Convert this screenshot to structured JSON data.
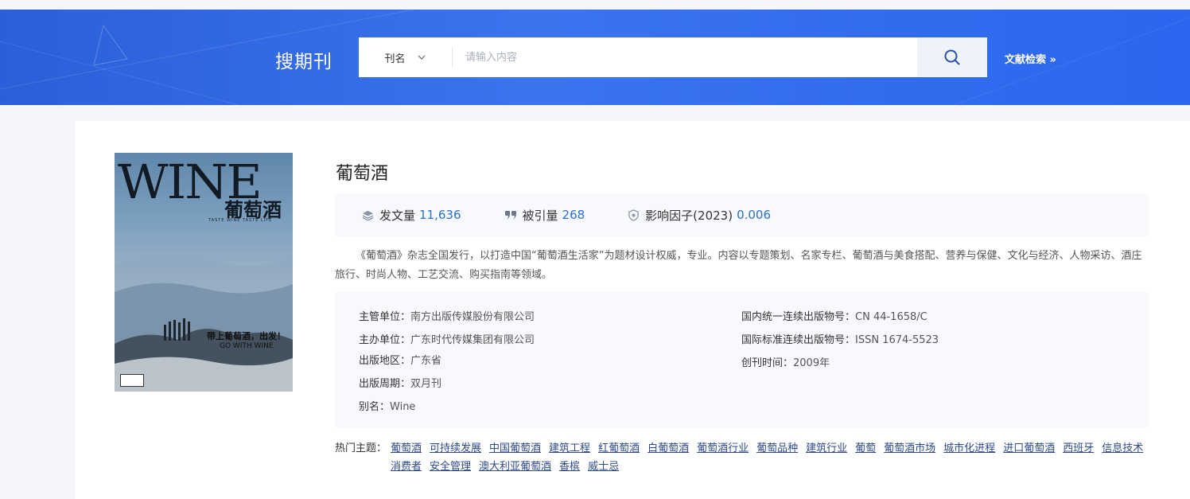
{
  "header": {
    "title": "搜期刊",
    "field_select": "刊名",
    "search_placeholder": "请输入内容",
    "advanced_link": "文献检索 »"
  },
  "journal": {
    "title": "葡萄酒",
    "cover": {
      "wine": "WINE",
      "cn": "葡萄酒",
      "sub": "TASTE WINE TASTE LIFE",
      "slogan": "带上葡萄酒，出发！",
      "slogan_en": "GO WITH WINE"
    },
    "stats": [
      {
        "label": "发文量",
        "value": "11,636",
        "icon": "stack-icon"
      },
      {
        "label": "被引量",
        "value": "268",
        "icon": "quote-icon"
      },
      {
        "label": "影响因子(2023)",
        "value": "0.006",
        "icon": "shield-icon"
      }
    ],
    "description": "《葡萄酒》杂志全国发行，以打造中国“葡萄酒生活家”为题材设计权威，专业。内容以专题策划、名家专栏、葡萄酒与美食搭配、营养与保健、文化与经济、人物采访、酒庄旅行、时尚人物、工艺交流、购买指南等领域。",
    "info_left": [
      {
        "label": "主管单位：",
        "value": "南方出版传媒股份有限公司"
      },
      {
        "label": "主办单位：",
        "value": "广东时代传媒集团有限公司"
      },
      {
        "label": "出版地区：",
        "value": "广东省"
      },
      {
        "label": "出版周期：",
        "value": "双月刊"
      },
      {
        "label": "别名：",
        "value": "Wine"
      }
    ],
    "info_right": [
      {
        "label": "国内统一连续出版物号：",
        "value": "CN 44-1658/C"
      },
      {
        "label": "国际标准连续出版物号：",
        "value": "ISSN 1674-5523"
      },
      {
        "label": "创刊时间：",
        "value": "2009年"
      }
    ],
    "topics_label": "热门主题：",
    "topics": [
      "葡萄酒",
      "可持续发展",
      "中国葡萄酒",
      "建筑工程",
      "红葡萄酒",
      "白葡萄酒",
      "葡萄酒行业",
      "葡萄品种",
      "建筑行业",
      "葡萄",
      "葡萄酒市场",
      "城市化进程",
      "进口葡萄酒",
      "西班牙",
      "信息技术",
      "消费者",
      "安全管理",
      "澳大利亚葡萄酒",
      "香槟",
      "威士忌"
    ]
  },
  "colors": {
    "banner": "#3a74ef",
    "accent": "#2b6fcf",
    "topic_link": "#2f4a8a"
  }
}
